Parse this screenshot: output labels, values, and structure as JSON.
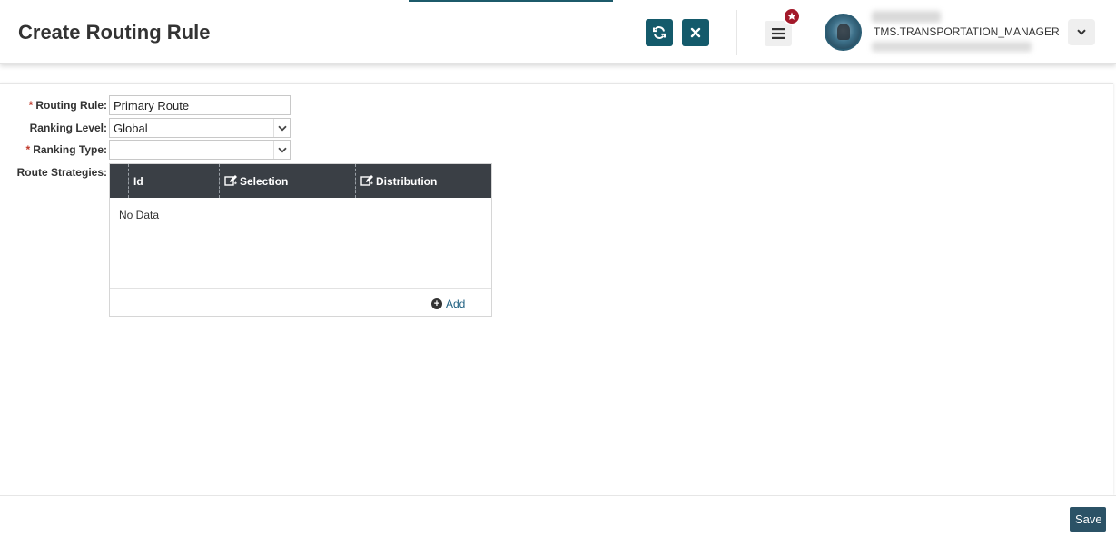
{
  "header": {
    "title": "Create Routing Rule",
    "refresh_icon": "refresh-icon",
    "close_icon": "close-icon",
    "menu_icon": "hamburger-menu-icon",
    "badge_icon": "star-icon",
    "user_role": "TMS.TRANSPORTATION_MANAGER",
    "user_menu_icon": "chevron-down-icon",
    "accent_color": "#145a6b",
    "badge_color": "#a3192a"
  },
  "form": {
    "routing_rule": {
      "label": "Routing Rule:",
      "required": "*",
      "value": "Primary Route"
    },
    "ranking_level": {
      "label": "Ranking Level:",
      "value": "Global"
    },
    "ranking_type": {
      "label": "Ranking Type:",
      "required": "*",
      "value": ""
    },
    "route_strategies": {
      "label": "Route Strategies:"
    }
  },
  "grid": {
    "columns": [
      {
        "label": "Id"
      },
      {
        "label": "Selection",
        "icon": "edit-icon"
      },
      {
        "label": "Distribution",
        "icon": "edit-icon"
      }
    ],
    "empty_text": "No Data",
    "add_label": "Add"
  },
  "footer": {
    "save_label": "Save"
  }
}
